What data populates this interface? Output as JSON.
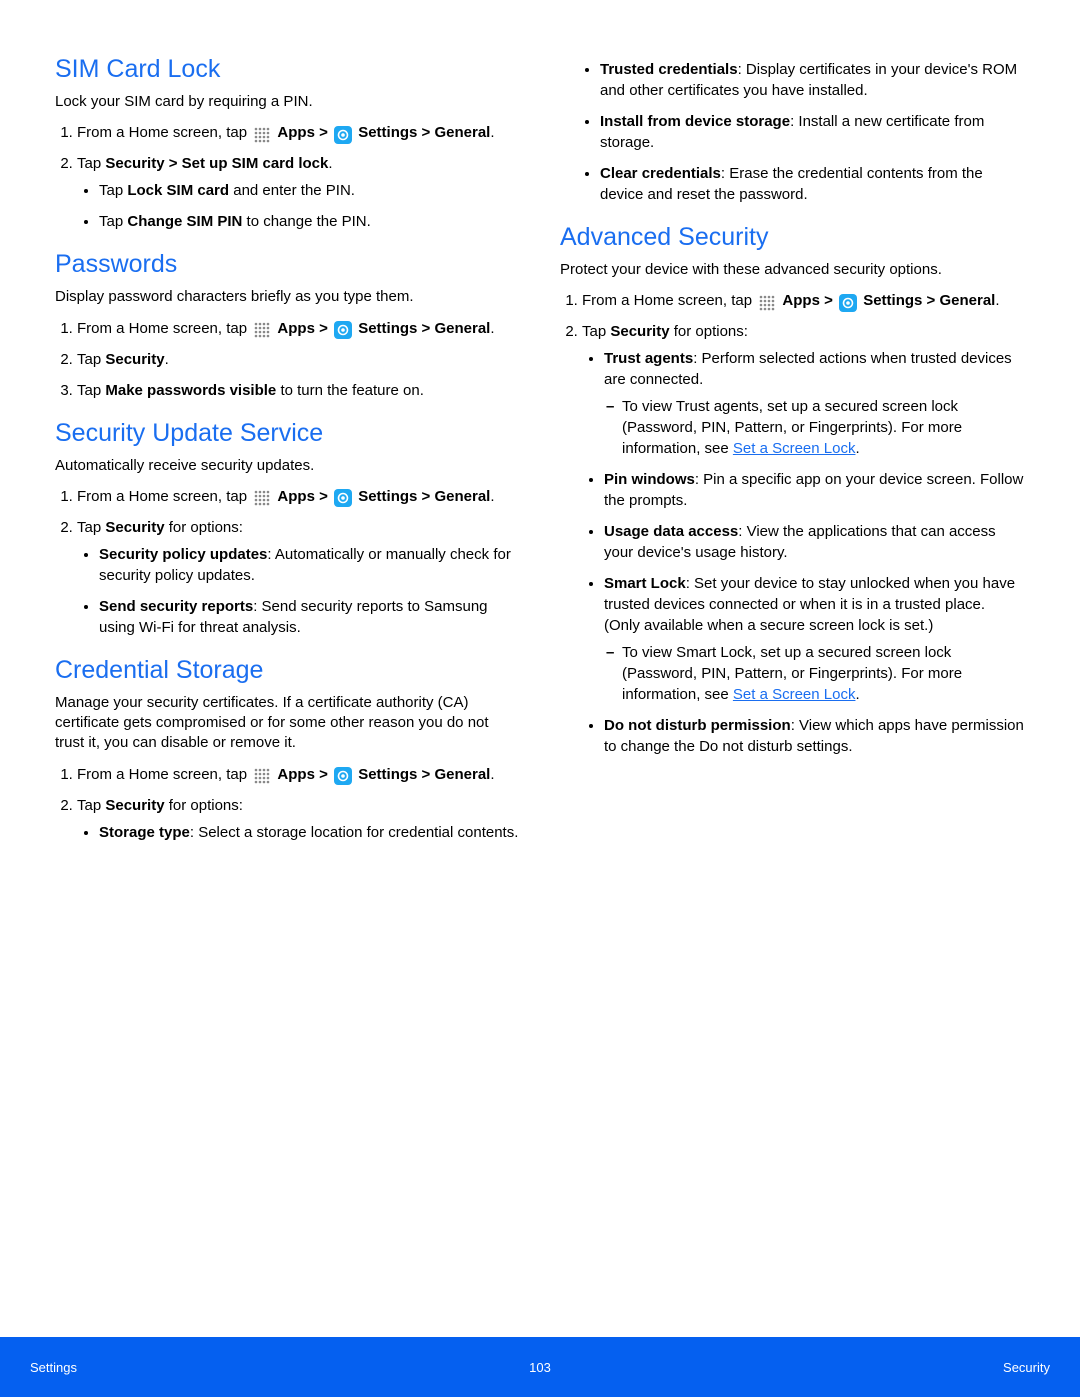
{
  "icons": {
    "apps_label": "Apps",
    "settings_label": "Settings"
  },
  "common": {
    "home_prefix": "From a Home screen, tap ",
    "gt": " > ",
    "general": "General",
    "tap_security_options": "Tap ",
    "security_word": "Security",
    "for_options": " for options:"
  },
  "left": {
    "s1": {
      "title": "SIM Card Lock",
      "intro": "Lock your SIM card by requiring a PIN.",
      "step2_pre": "Tap ",
      "step2_bold": "Security > Set up SIM card lock",
      "step2_post": ".",
      "b1_pre": "Tap ",
      "b1_bold": "Lock SIM card",
      "b1_post": " and enter the PIN.",
      "b2_pre": "Tap ",
      "b2_bold": "Change SIM PIN",
      "b2_post": " to change the PIN."
    },
    "s2": {
      "title": "Passwords",
      "intro": "Display password characters briefly as you type them.",
      "step2_pre": "Tap ",
      "step2_bold": "Security",
      "step2_post": ".",
      "step3_pre": "Tap ",
      "step3_bold": "Make passwords visible",
      "step3_post": " to turn the feature on."
    },
    "s3": {
      "title": "Security Update Service",
      "intro": "Automatically receive security updates.",
      "b1_bold": "Security policy updates",
      "b1_post": ": Automatically or manually check for security policy updates.",
      "b2_bold": "Send security reports",
      "b2_post": ": Send security reports to Samsung using Wi-Fi for threat analysis."
    },
    "s4": {
      "title": "Credential Storage",
      "intro": "Manage your security certificates. If a certificate authority (CA) certificate gets compromised or for some other reason you do not trust it, you can disable or remove it.",
      "b1_bold": "Storage type",
      "b1_post": ": Select a storage location for credential contents."
    }
  },
  "right": {
    "cont": {
      "b1_bold": "Trusted credentials",
      "b1_post": ": Display certificates in your device's ROM and other certificates you have installed.",
      "b2_bold": "Install from device storage",
      "b2_post": ": Install a new certificate from storage.",
      "b3_bold": "Clear credentials",
      "b3_post": ": Erase the credential contents from the device and reset the password."
    },
    "s5": {
      "title": "Advanced Security",
      "intro": "Protect your device with these advanced security options.",
      "b1_bold": "Trust agents",
      "b1_post": ": Perform selected actions when trusted devices are connected.",
      "b1_sub_text": "To view Trust agents, set up a secured screen lock (Password, PIN, Pattern, or Fingerprints). For more information, see ",
      "b1_sub_link": "Set a Screen Lock",
      "b1_sub_post": ".",
      "b2_bold": "Pin windows",
      "b2_post": ": Pin a specific app on your device screen. Follow the prompts.",
      "b3_bold": "Usage data access",
      "b3_post": ": View the applications that can access your device's usage history.",
      "b4_bold": "Smart Lock",
      "b4_post": ": Set your device to stay unlocked when you have trusted devices connected or when it is in a trusted place. (Only available when a secure screen lock is set.)",
      "b4_sub_text": "To view Smart Lock, set up a secured screen lock (Password, PIN, Pattern, or Fingerprints). For more information, see ",
      "b4_sub_link": "Set a Screen Lock",
      "b4_sub_post": ".",
      "b5_bold": "Do not disturb permission",
      "b5_post": ": View which apps have permission to change the Do not disturb settings."
    }
  },
  "footer": {
    "left": "Settings",
    "center": "103",
    "right": "Security"
  }
}
